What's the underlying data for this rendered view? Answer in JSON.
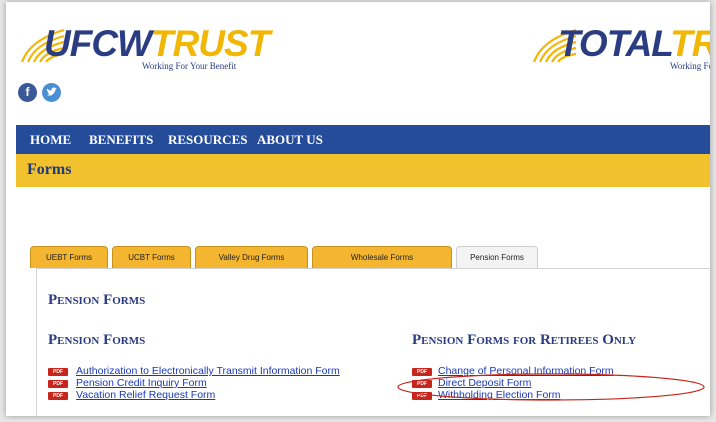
{
  "header": {
    "logo_left": {
      "part1": "UFCW",
      "part2": "TRUST",
      "tagline": "Working For Your Benefit"
    },
    "logo_right": {
      "part1": "TOTAL",
      "part2": "TRUST",
      "tagline": "Working For Your Benefit"
    },
    "social": {
      "facebook": "f",
      "twitter": "t"
    }
  },
  "nav": {
    "items": [
      "HOME",
      "BENEFITS",
      "RESOURCES",
      "ABOUT US"
    ]
  },
  "page": {
    "title": "Forms"
  },
  "tabs": [
    "UEBT Forms",
    "UCBT Forms",
    "Valley Drug Forms",
    "Wholesale Forms",
    "Pension Forms"
  ],
  "active_tab": "Pension Forms",
  "content": {
    "section_title": "Pension Forms",
    "left": {
      "heading": "Pension Forms",
      "links": [
        "Authorization to Electronically Transmit Information Form",
        "Pension Credit Inquiry Form",
        "Vacation Relief Request Form"
      ]
    },
    "right": {
      "heading": "Pension Forms for Retirees Only",
      "links": [
        "Change of Personal Information Form",
        "Direct Deposit Form",
        "Withholding Election Form"
      ]
    },
    "pdf_badge": "PDF"
  },
  "colors": {
    "navy": "#244c99",
    "gold": "#f2c12e",
    "tab": "#f4b531",
    "pdf": "#c8251c",
    "annotation": "#c8251c"
  }
}
